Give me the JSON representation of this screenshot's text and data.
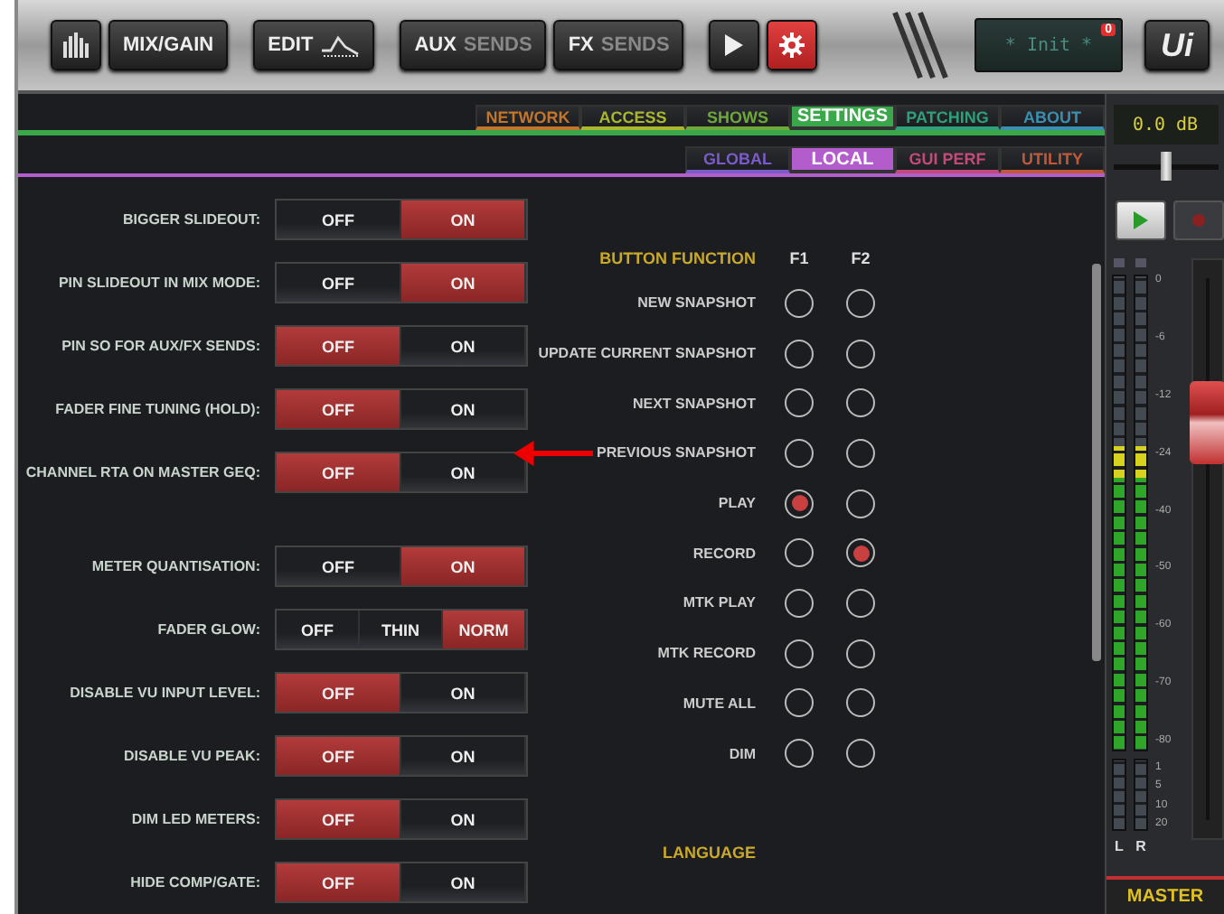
{
  "toolbar": {
    "buttons": [
      {
        "kind": "meters"
      },
      {
        "kind": "text",
        "label": "MIX/GAIN"
      },
      {
        "kind": "edit",
        "label": "EDIT"
      },
      {
        "kind": "split",
        "strong": "AUX",
        "dim": "SENDS"
      },
      {
        "kind": "split",
        "strong": "FX",
        "dim": "SENDS"
      },
      {
        "kind": "play"
      },
      {
        "kind": "settings",
        "selected": true
      }
    ],
    "display": "* Init *",
    "badge": "0",
    "logo": "Ui"
  },
  "main_tabs": [
    {
      "label": "NETWORK",
      "color": "#c0762c",
      "selected": false
    },
    {
      "label": "ACCESS",
      "color": "#a9b62e",
      "selected": false
    },
    {
      "label": "SHOWS",
      "color": "#6fa83a",
      "selected": false
    },
    {
      "label": "SETTINGS",
      "color": "#3aa84a",
      "selected": true
    },
    {
      "label": "PATCHING",
      "color": "#2f9e7a",
      "selected": false
    },
    {
      "label": "ABOUT",
      "color": "#3a8fb0",
      "selected": false
    }
  ],
  "sub_tabs": [
    {
      "label": "GLOBAL",
      "color": "#7a5cc8",
      "selected": false
    },
    {
      "label": "LOCAL",
      "color": "#b35ccc",
      "selected": true
    },
    {
      "label": "GUI PERF",
      "color": "#c04a7a",
      "selected": false
    },
    {
      "label": "UTILITY",
      "color": "#c0583a",
      "selected": false
    }
  ],
  "settings": [
    {
      "label": "BIGGER SLIDEOUT:",
      "options": [
        {
          "label": "OFF",
          "selected": false
        },
        {
          "label": "ON",
          "selected": true
        }
      ]
    },
    {
      "label": "PIN SLIDEOUT IN MIX MODE:",
      "options": [
        {
          "label": "OFF",
          "selected": false
        },
        {
          "label": "ON",
          "selected": true
        }
      ]
    },
    {
      "label": "PIN SO FOR AUX/FX SENDS:",
      "options": [
        {
          "label": "OFF",
          "selected": true
        },
        {
          "label": "ON",
          "selected": false
        }
      ]
    },
    {
      "label": "FADER FINE TUNING (HOLD):",
      "options": [
        {
          "label": "OFF",
          "selected": true
        },
        {
          "label": "ON",
          "selected": false
        }
      ]
    },
    {
      "label": "CHANNEL RTA ON MASTER GEQ:",
      "options": [
        {
          "label": "OFF",
          "selected": true
        },
        {
          "label": "ON",
          "selected": false
        }
      ]
    },
    {
      "label": "METER QUANTISATION:",
      "options": [
        {
          "label": "OFF",
          "selected": false
        },
        {
          "label": "ON",
          "selected": true
        }
      ]
    },
    {
      "label": "FADER GLOW:",
      "options": [
        {
          "label": "OFF",
          "selected": false
        },
        {
          "label": "THIN",
          "selected": false
        },
        {
          "label": "NORM",
          "selected": true
        }
      ]
    },
    {
      "label": "DISABLE VU INPUT LEVEL:",
      "options": [
        {
          "label": "OFF",
          "selected": true
        },
        {
          "label": "ON",
          "selected": false
        }
      ]
    },
    {
      "label": "DISABLE VU PEAK:",
      "options": [
        {
          "label": "OFF",
          "selected": true
        },
        {
          "label": "ON",
          "selected": false
        }
      ]
    },
    {
      "label": "DIM LED METERS:",
      "options": [
        {
          "label": "OFF",
          "selected": true
        },
        {
          "label": "ON",
          "selected": false
        }
      ]
    },
    {
      "label": "HIDE COMP/GATE:",
      "options": [
        {
          "label": "OFF",
          "selected": true
        },
        {
          "label": "ON",
          "selected": false
        }
      ]
    }
  ],
  "button_function": {
    "title": "BUTTON FUNCTION",
    "columns": [
      "F1",
      "F2"
    ],
    "rows": [
      {
        "label": "NEW SNAPSHOT",
        "f1": false,
        "f2": false
      },
      {
        "label": "UPDATE CURRENT SNAPSHOT",
        "f1": false,
        "f2": false
      },
      {
        "label": "NEXT SNAPSHOT",
        "f1": false,
        "f2": false
      },
      {
        "label": "PREVIOUS SNAPSHOT",
        "f1": false,
        "f2": false
      },
      {
        "label": "PLAY",
        "f1": true,
        "f2": false
      },
      {
        "label": "RECORD",
        "f1": false,
        "f2": true
      },
      {
        "label": "MTK PLAY",
        "f1": false,
        "f2": false
      },
      {
        "label": "MTK RECORD",
        "f1": false,
        "f2": false
      },
      {
        "label": "MUTE ALL",
        "f1": false,
        "f2": false
      },
      {
        "label": "DIM",
        "f1": false,
        "f2": false
      }
    ]
  },
  "language": {
    "title": "LANGUAGE"
  },
  "master": {
    "reading": "0.0 dB",
    "pan": {
      "level": 0.5
    },
    "fader": {
      "level": 0.72
    },
    "meters": [
      {
        "label": "L",
        "level": 0.64
      },
      {
        "label": "R",
        "level": 0.64
      }
    ],
    "scale": [
      "0",
      "-6",
      "-12",
      "-24",
      "-40",
      "-50",
      "-60",
      "-70",
      "-80"
    ],
    "gr_scale": [
      "1",
      "5",
      "10",
      "20"
    ],
    "name": "MASTER"
  }
}
